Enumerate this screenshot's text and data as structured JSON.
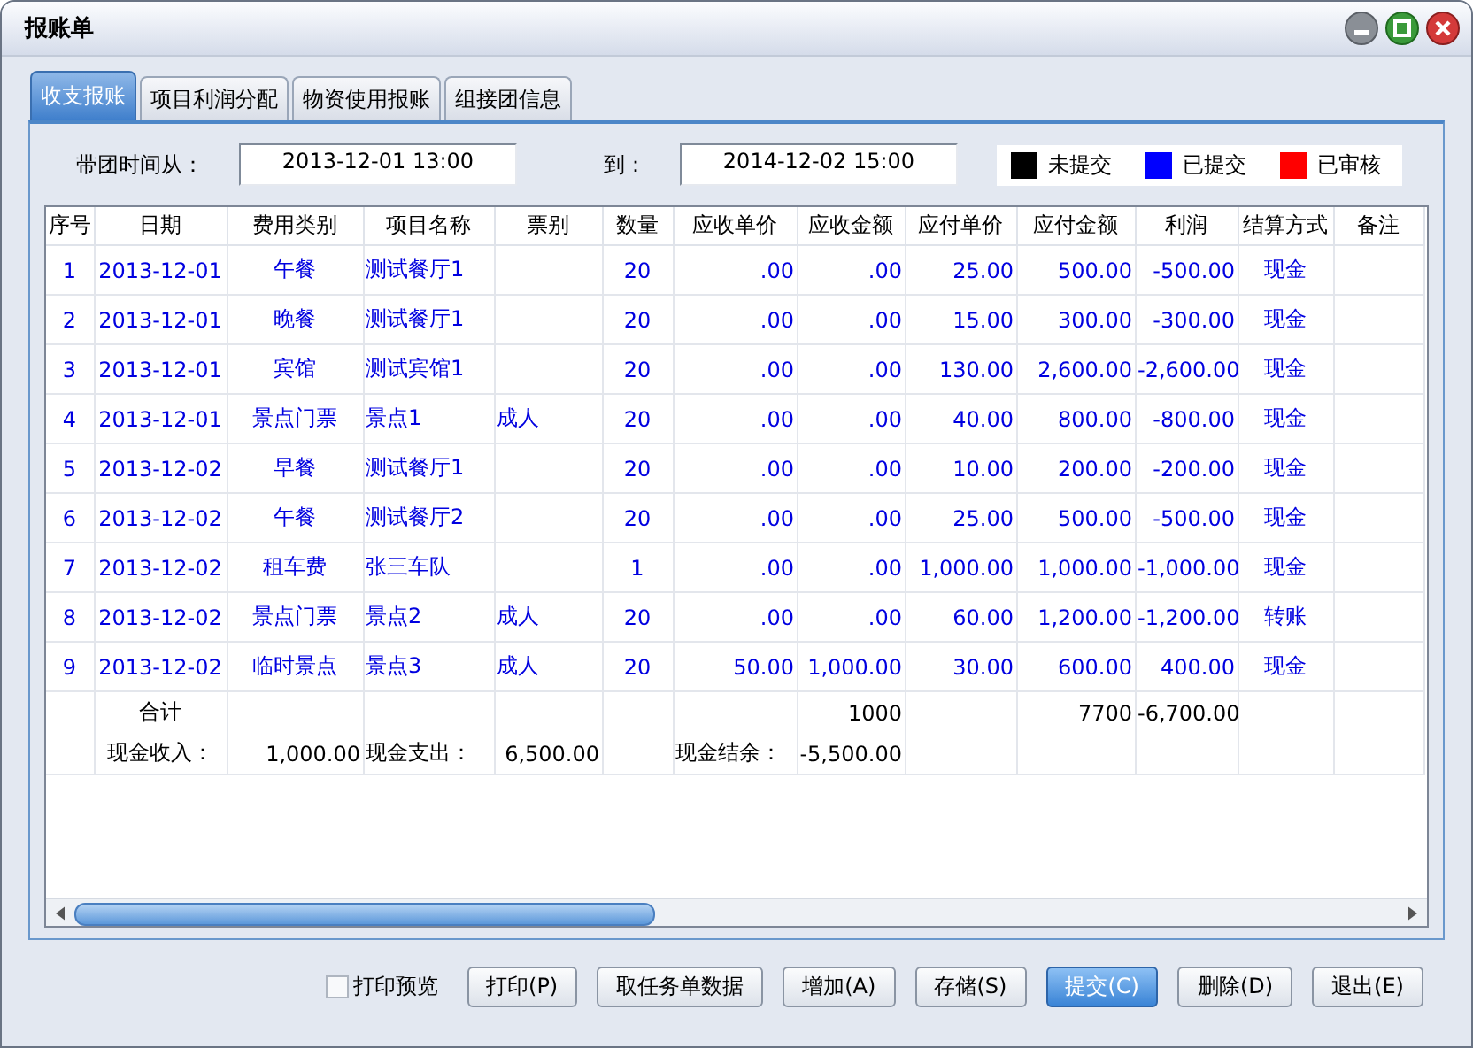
{
  "window": {
    "title": "报账单"
  },
  "tabs": [
    {
      "label": "收支报账",
      "selected": true
    },
    {
      "label": "项目利润分配",
      "selected": false
    },
    {
      "label": "物资使用报账",
      "selected": false
    },
    {
      "label": "组接团信息",
      "selected": false
    }
  ],
  "filter": {
    "from_label": "带团时间从：",
    "from_value": "2013-12-01 13:00",
    "to_label": "到：",
    "to_value": "2014-12-02 15:00"
  },
  "legend": [
    {
      "label": "未提交",
      "color": "#000000"
    },
    {
      "label": "已提交",
      "color": "#0000ff"
    },
    {
      "label": "已审核",
      "color": "#ff0000"
    }
  ],
  "table": {
    "columns": [
      "序号",
      "日期",
      "费用类别",
      "项目名称",
      "票别",
      "数量",
      "应收单价",
      "应收金额",
      "应付单价",
      "应付金额",
      "利润",
      "结算方式",
      "备注"
    ],
    "rows": [
      {
        "seq": "1",
        "date": "2013-12-01",
        "category": "午餐",
        "item": "测试餐厅1",
        "qty": "20",
        "recv_price": ".00",
        "recv_amount": ".00",
        "pay_price": "25.00",
        "pay_amount": "500.00",
        "profit": "-500.00",
        "settlement": "现金"
      },
      {
        "seq": "2",
        "date": "2013-12-01",
        "category": "晚餐",
        "item": "测试餐厅1",
        "qty": "20",
        "recv_price": ".00",
        "recv_amount": ".00",
        "pay_price": "15.00",
        "pay_amount": "300.00",
        "profit": "-300.00",
        "settlement": "现金"
      },
      {
        "seq": "3",
        "date": "2013-12-01",
        "category": "宾馆",
        "item": "测试宾馆1",
        "qty": "20",
        "recv_price": ".00",
        "recv_amount": ".00",
        "pay_price": "130.00",
        "pay_amount": "2,600.00",
        "profit": "-2,600.00",
        "settlement": "现金"
      },
      {
        "seq": "4",
        "date": "2013-12-01",
        "category": "景点门票",
        "item": "景点1",
        "ticket": "成人",
        "qty": "20",
        "recv_price": ".00",
        "recv_amount": ".00",
        "pay_price": "40.00",
        "pay_amount": "800.00",
        "profit": "-800.00",
        "settlement": "现金"
      },
      {
        "seq": "5",
        "date": "2013-12-02",
        "category": "早餐",
        "item": "测试餐厅1",
        "qty": "20",
        "recv_price": ".00",
        "recv_amount": ".00",
        "pay_price": "10.00",
        "pay_amount": "200.00",
        "profit": "-200.00",
        "settlement": "现金"
      },
      {
        "seq": "6",
        "date": "2013-12-02",
        "category": "午餐",
        "item": "测试餐厅2",
        "qty": "20",
        "recv_price": ".00",
        "recv_amount": ".00",
        "pay_price": "25.00",
        "pay_amount": "500.00",
        "profit": "-500.00",
        "settlement": "现金"
      },
      {
        "seq": "7",
        "date": "2013-12-02",
        "category": "租车费",
        "item": "张三车队",
        "qty": "1",
        "recv_price": ".00",
        "recv_amount": ".00",
        "pay_price": "1,000.00",
        "pay_amount": "1,000.00",
        "profit": "-1,000.00",
        "settlement": "现金"
      },
      {
        "seq": "8",
        "date": "2013-12-02",
        "category": "景点门票",
        "item": "景点2",
        "ticket": "成人",
        "qty": "20",
        "recv_price": ".00",
        "recv_amount": ".00",
        "pay_price": "60.00",
        "pay_amount": "1,200.00",
        "profit": "-1,200.00",
        "settlement": "转账"
      },
      {
        "seq": "9",
        "date": "2013-12-02",
        "category": "临时景点",
        "item": "景点3",
        "ticket": "成人",
        "qty": "20",
        "recv_price": "50.00",
        "recv_amount": "1,000.00",
        "pay_price": "30.00",
        "pay_amount": "600.00",
        "profit": "400.00",
        "settlement": "现金"
      }
    ],
    "summary": [
      {
        "date": "合计",
        "recv_amount": "1000",
        "pay_amount": "7700",
        "profit": "-6,700.00"
      },
      {
        "date": "现金收入：",
        "category": "1,000.00",
        "item": "现金支出：",
        "ticket": "6,500.00",
        "recv_price": "现金结余：",
        "recv_amount": "-5,500.00"
      }
    ]
  },
  "print_preview": {
    "label": "打印预览",
    "checked": false
  },
  "buttons": [
    {
      "label": "打印(P)",
      "selected": false
    },
    {
      "label": "取任务单数据",
      "selected": false
    },
    {
      "label": "增加(A)",
      "selected": false
    },
    {
      "label": "存储(S)",
      "selected": false
    },
    {
      "label": "提交(C)",
      "selected": true
    },
    {
      "label": "删除(D)",
      "selected": false
    },
    {
      "label": "退出(E)",
      "selected": false
    }
  ]
}
